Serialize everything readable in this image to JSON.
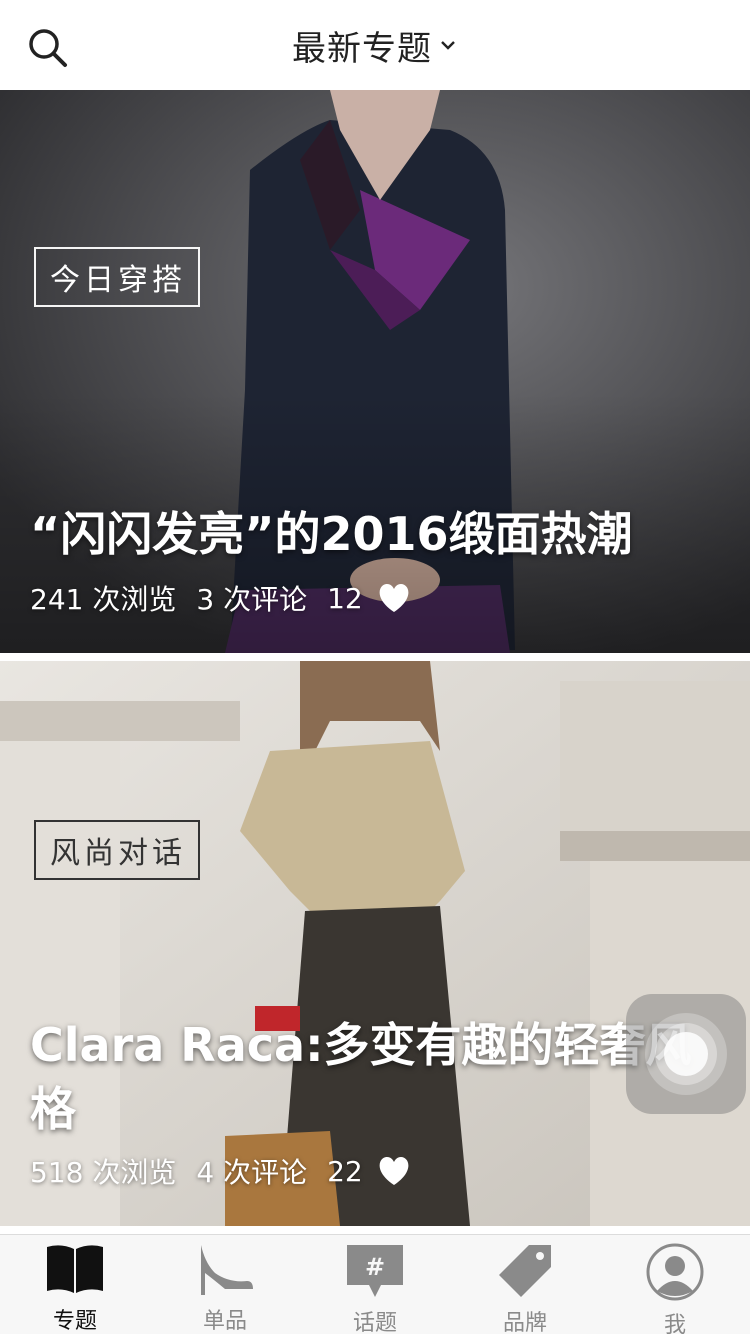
{
  "header": {
    "title": "最新专题",
    "icons": {
      "search": "search-icon",
      "dropdown": "chevron-down-icon"
    }
  },
  "cards": [
    {
      "tag": "今日穿搭",
      "title": "“闪闪发亮”的2016缎面热潮",
      "views": "241 次浏览",
      "comments": "3 次评论",
      "likes": "12"
    },
    {
      "tag": "风尚对话",
      "title": "Clara Raca:多变有趣的轻奢风格",
      "views": "518 次浏览",
      "comments": "4 次评论",
      "likes": "22"
    }
  ],
  "tabbar": {
    "active_index": 0,
    "items": [
      {
        "label": "专题",
        "icon": "book-icon"
      },
      {
        "label": "单品",
        "icon": "high-heel-icon"
      },
      {
        "label": "话题",
        "icon": "hashtag-bubble-icon"
      },
      {
        "label": "品牌",
        "icon": "price-tag-icon"
      },
      {
        "label": "我",
        "icon": "user-avatar-icon"
      }
    ]
  },
  "colors": {
    "tab_active": "#111111",
    "tab_inactive": "#8a8a8a",
    "accent_purple": "#6b2a7a"
  }
}
